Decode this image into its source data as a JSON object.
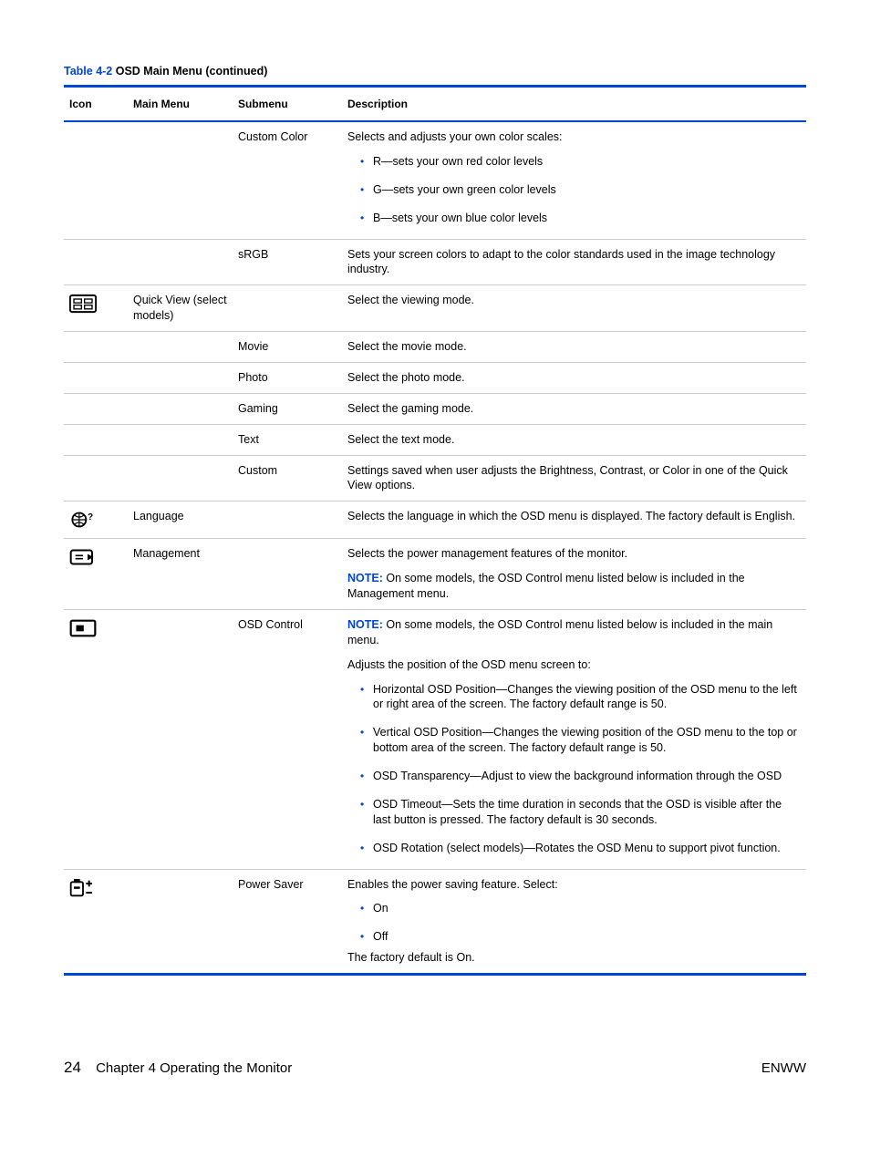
{
  "caption": {
    "number": "Table 4-2",
    "title": "  OSD Main Menu (continued)"
  },
  "headers": {
    "icon": "Icon",
    "main": "Main Menu",
    "sub": "Submenu",
    "desc": "Description"
  },
  "rows": {
    "customColor": {
      "sub": "Custom Color",
      "lead": "Selects and adjusts your own color scales:",
      "bullets": [
        "R—sets your own red color levels",
        "G—sets your own green color levels",
        "B—sets your own blue color levels"
      ]
    },
    "srgb": {
      "sub": "sRGB",
      "desc": "Sets your screen colors to adapt to the color standards used in the image technology industry."
    },
    "quickView": {
      "main": "Quick View (select models)",
      "desc": "Select the viewing mode."
    },
    "movie": {
      "sub": "Movie",
      "desc": "Select the movie mode."
    },
    "photo": {
      "sub": "Photo",
      "desc": "Select the photo mode."
    },
    "gaming": {
      "sub": "Gaming",
      "desc": "Select the gaming mode."
    },
    "text": {
      "sub": "Text",
      "desc": "Select the text mode."
    },
    "custom": {
      "sub": "Custom",
      "desc": "Settings saved when user adjusts the Brightness, Contrast, or Color in one of the Quick View options."
    },
    "language": {
      "main": "Language",
      "desc": "Selects the language in which the OSD menu is displayed. The factory default is English."
    },
    "management": {
      "main": "Management",
      "desc": "Selects the power management features of the monitor.",
      "noteLead": "NOTE:",
      "noteText": "   On some models, the OSD Control menu listed below is included in the Management menu."
    },
    "osdControl": {
      "sub": "OSD Control",
      "noteLead": "NOTE:",
      "noteText": "   On some models, the OSD Control menu listed below is included in the main menu.",
      "lead2": "Adjusts the position of the OSD menu screen to:",
      "bullets": [
        "Horizontal OSD Position—Changes the viewing position of the OSD menu to the left or right area of the screen. The factory default range is 50.",
        "Vertical OSD Position—Changes the viewing position of the OSD menu to the top or bottom area of the screen. The factory default range is 50.",
        "OSD Transparency—Adjust to view the background information through the OSD",
        "OSD Timeout—Sets the time duration in seconds that the OSD is visible after the last button is pressed. The factory default is 30 seconds.",
        "OSD Rotation (select models)—Rotates the OSD Menu to support pivot function."
      ]
    },
    "powerSaver": {
      "sub": "Power Saver",
      "lead": "Enables the power saving feature. Select:",
      "bullets": [
        "On",
        "Off"
      ],
      "trail": "The factory default is On."
    }
  },
  "footer": {
    "pagenum": "24",
    "chapter": "Chapter 4   Operating the Monitor",
    "right": "ENWW"
  }
}
